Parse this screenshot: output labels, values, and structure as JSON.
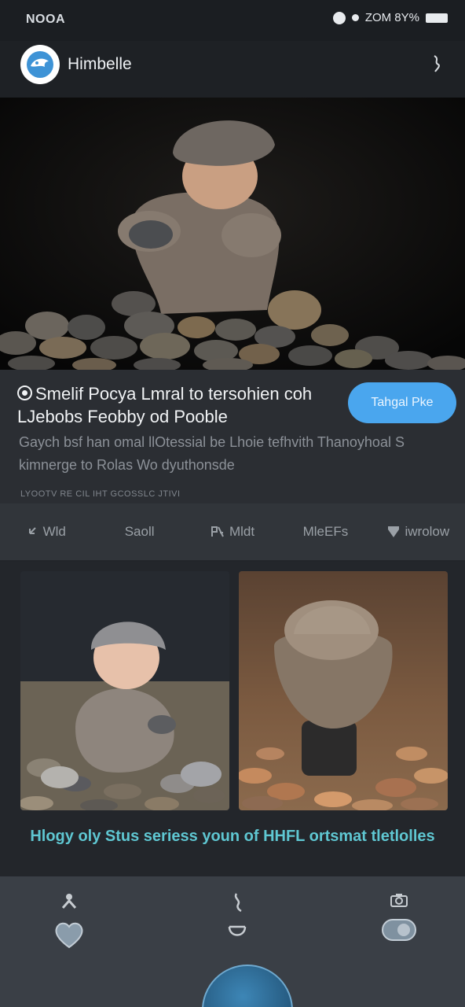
{
  "status_bar": {
    "carrier": "NOOA",
    "right_text": "ZOM 8Y%"
  },
  "header": {
    "app_name": "Himbelle",
    "logo_icon": "bird-logo-icon",
    "action_icon": "squiggle-icon"
  },
  "post": {
    "title": "Smelif Pocya Lmral to tersohien coh LJebobs Feobby od Pooble",
    "cta_label": "Tahgal Pke",
    "description": "Gaych bsf han omal llOtessial be Lhoie tefhvith Thanoyhoal S kimnerge to Rolas Wo dyuthonsde",
    "meta": "LYOOTV RE CIL IHT GCOSSLC JTIVI"
  },
  "actions": [
    {
      "label": "Wld",
      "icon": "back-arrow-icon"
    },
    {
      "label": "Saoll",
      "icon": "dollar-icon"
    },
    {
      "label": "Mldt",
      "icon": "translate-icon"
    },
    {
      "label": "MleEFs",
      "icon": "tag-icon"
    },
    {
      "label": "iwrolow",
      "icon": "shield-icon"
    }
  ],
  "gallery": {
    "caption": "Hlogy oly Stus seriess youn of HHFL ortsmat tletlolles"
  },
  "bottom_nav": [
    {
      "name": "nav-profile",
      "top_icon": "person-icon",
      "bottom_icon": "heart-icon"
    },
    {
      "name": "nav-chat",
      "top_icon": "hook-icon",
      "bottom_icon": "smile-icon"
    },
    {
      "name": "nav-camera",
      "top_icon": "camera-icon",
      "bottom_icon": "toggle-icon"
    }
  ],
  "colors": {
    "accent": "#4aa6ee",
    "caption": "#5fc7d2",
    "background": "#22252a"
  }
}
